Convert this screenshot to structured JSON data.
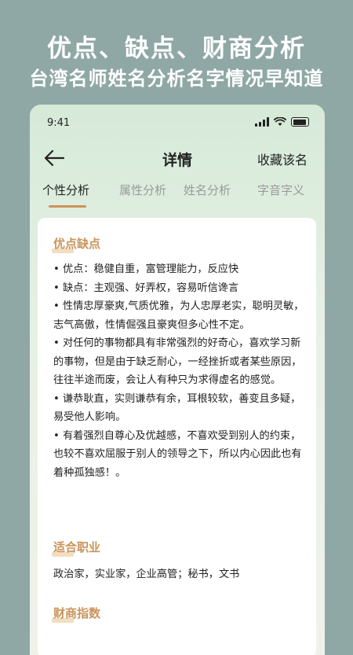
{
  "hero": {
    "title": "优点、缺点、财商分析",
    "subtitle": "台湾名师姓名分析名字情况早知道"
  },
  "status_bar": {
    "time": "9:41"
  },
  "nav": {
    "title": "详情",
    "favorite_label": "收藏该名"
  },
  "tabs": [
    "个性分析",
    "属性分析",
    "姓名分析",
    "字音字义"
  ],
  "sections": {
    "pros_cons": {
      "title": "优点缺点",
      "items": [
        "• 优点：稳健自重，富管理能力，反应快",
        "• 缺点：主观强、好弄权，容易听信谗言",
        "• 性情忠厚豪爽,气质优雅，为人忠厚老实，聪明灵敏，志气高傲，性情倔强且豪爽但多心性不定。",
        "• 对任何的事物都具有非常强烈的好奇心，喜欢学习新的事物，但是由于缺乏耐心，一经挫折或者某些原因，往往半途而废，会让人有种只为求得虚名的感觉。",
        "• 谦恭耿直，实则谦恭有余，耳根较软，善变且多疑，易受他人影响。",
        "• 有着强烈自尊心及优越感，不喜欢受到别人的约束，也较不喜欢屈服于别人的领导之下，所以内心因此也有着种孤独感！。"
      ]
    },
    "career": {
      "title": "适合职业",
      "content": "政治家，实业家，企业高管；秘书，文书"
    },
    "wealth": {
      "title": "财商指数"
    }
  },
  "colors": {
    "background": "#8fa8a6",
    "accent": "#c9945a",
    "tab_inactive": "#9a9a9a"
  }
}
